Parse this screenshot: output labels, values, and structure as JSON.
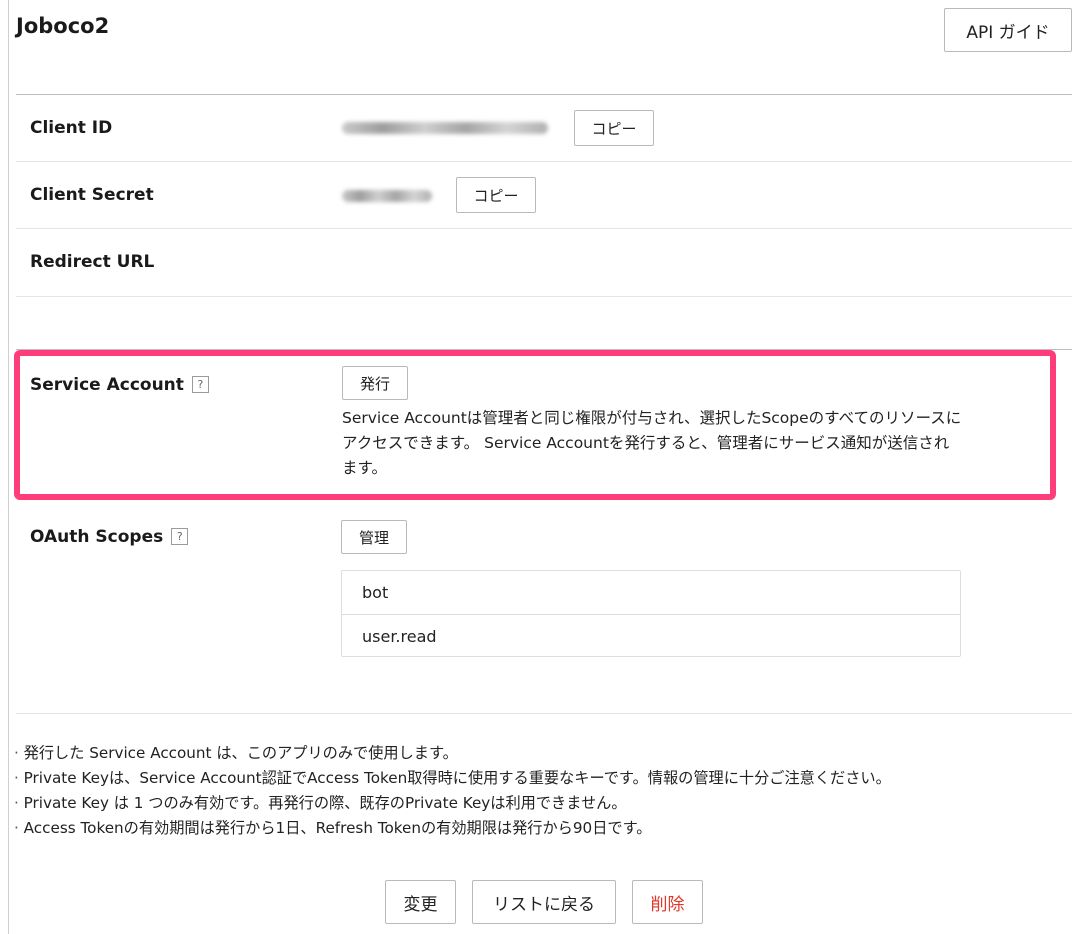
{
  "app": {
    "title": "Joboco2"
  },
  "header": {
    "api_guide_label": "API ガイド"
  },
  "fields": {
    "client_id_label": "Client ID",
    "client_secret_label": "Client Secret",
    "redirect_url_label": "Redirect URL",
    "copy_label": "コピー"
  },
  "service_account": {
    "label": "Service Account",
    "help_label": "?",
    "issue_label": "発行",
    "description": "Service Accountは管理者と同じ権限が付与され、選択したScopeのすべてのリソースにアクセスできます。 Service Accountを発行すると、管理者にサービス通知が送信されます。"
  },
  "oauth": {
    "label": "OAuth Scopes",
    "help_label": "?",
    "manage_label": "管理",
    "scopes": [
      "bot",
      "user.read"
    ]
  },
  "notes": [
    "発行した Service Account は、このアプリのみで使用します。",
    "Private Keyは、Service Account認証でAccess Token取得時に使用する重要なキーです。情報の管理に十分ご注意ください。",
    "Private Key は 1 つのみ有効です。再発行の際、既存のPrivate Keyは利用できません。",
    "Access Tokenの有効期間は発行から1日、Refresh Tokenの有効期限は発行から90日です。"
  ],
  "actions": {
    "change_label": "変更",
    "back_label": "リストに戻る",
    "delete_label": "削除"
  },
  "colors": {
    "highlight": "#ff3d7a",
    "danger": "#e0372b"
  }
}
